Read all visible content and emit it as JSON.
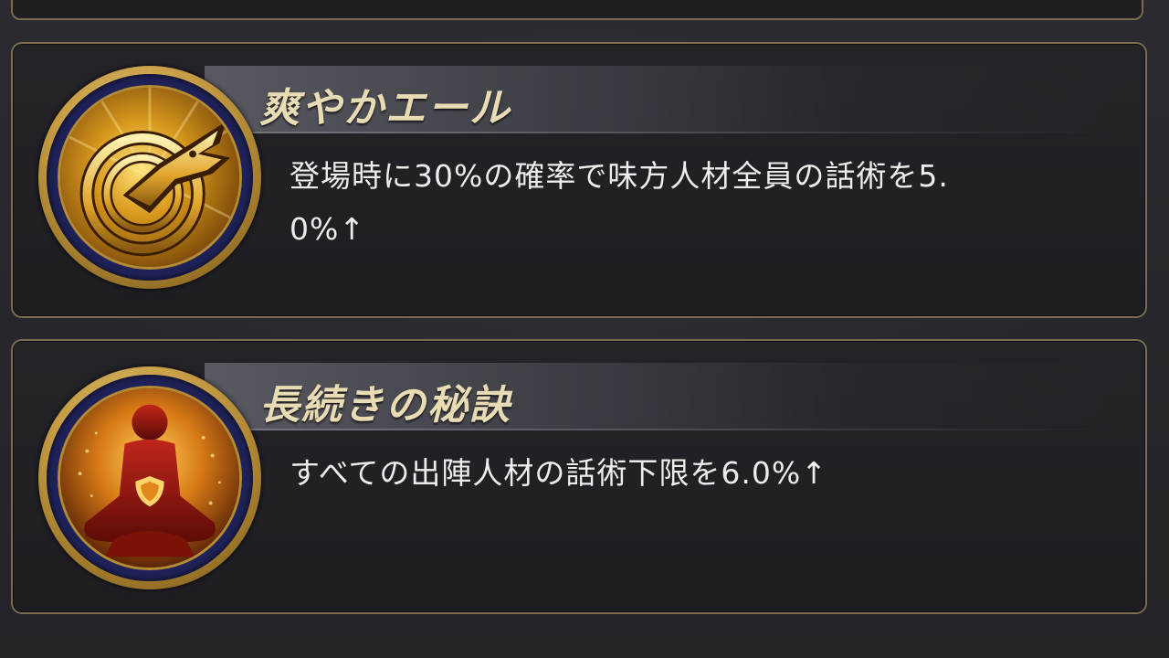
{
  "skills": [
    {
      "name": "爽やかエール",
      "desc_line1": "登場時に30%の確率で味方人材全員の話術を5.",
      "desc_line2": "0%↑",
      "icon": "crocodile-emblem-icon"
    },
    {
      "name": "長続きの秘訣",
      "desc_line1": "すべての出陣人材の話術下限を6.0%↑",
      "desc_line2": "",
      "icon": "meditating-figure-shield-icon"
    }
  ],
  "colors": {
    "card_border": "#7d6c4f",
    "title_text": "#e9dcb4",
    "desc_text": "#ededed",
    "medallion_gold": "#c49b42",
    "medallion_ring": "#1f2258"
  }
}
